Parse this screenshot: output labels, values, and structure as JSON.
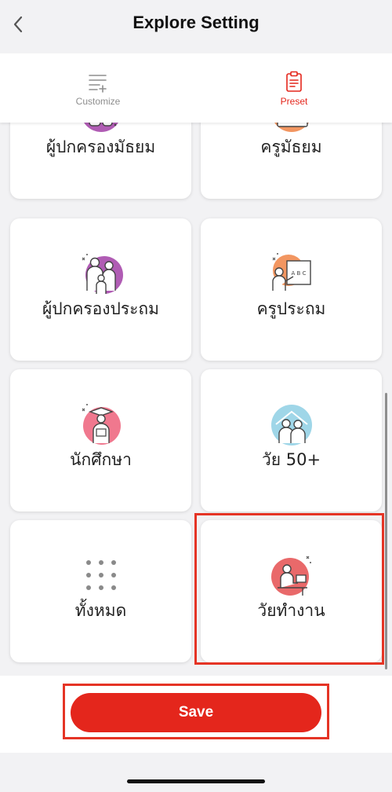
{
  "header": {
    "title": "Explore Setting"
  },
  "tabs": [
    {
      "label": "Customize",
      "color": "#8e8e8e"
    },
    {
      "label": "Preset",
      "color": "#e4261c"
    }
  ],
  "cards": [
    {
      "label": "ผู้ปกครองมัธยม",
      "icon": "parent-secondary-icon"
    },
    {
      "label": "ครูมัธยม",
      "icon": "teacher-secondary-icon"
    },
    {
      "label": "ผู้ปกครองประถม",
      "icon": "parent-primary-icon"
    },
    {
      "label": "ครูประถม",
      "icon": "teacher-primary-icon"
    },
    {
      "label": "นักศึกษา",
      "icon": "student-icon"
    },
    {
      "label": "วัย 50+",
      "icon": "seniors-icon"
    },
    {
      "label": "ทั้งหมด",
      "icon": "grid-dots-icon"
    },
    {
      "label": "วัยทำงาน",
      "icon": "working-age-icon"
    }
  ],
  "footer": {
    "save_label": "Save"
  },
  "colors": {
    "accent": "#e4261c",
    "highlight": "#e53425",
    "background": "#f2f2f4"
  }
}
